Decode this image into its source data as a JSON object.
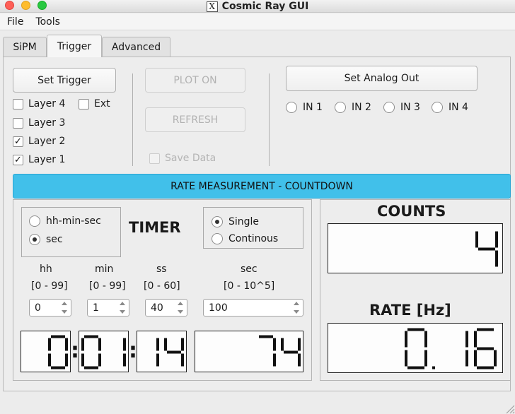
{
  "window": {
    "title": "Cosmic Ray GUI",
    "x_logo": "X"
  },
  "menu": [
    "File",
    "Tools"
  ],
  "tabs": [
    "SiPM",
    "Trigger",
    "Advanced"
  ],
  "trigger": {
    "set_trigger": "Set Trigger",
    "plot_on": "PLOT ON",
    "refresh": "REFRESH",
    "save_data": "Save Data",
    "set_analog_out": "Set Analog Out",
    "layers": [
      {
        "label": "Layer 4",
        "checked": false
      },
      {
        "label": "Layer 3",
        "checked": false
      },
      {
        "label": "Layer 2",
        "checked": true
      },
      {
        "label": "Layer 1",
        "checked": true
      }
    ],
    "ext": {
      "label": "Ext",
      "checked": false
    },
    "inputs": [
      "IN 1",
      "IN 2",
      "IN 3",
      "IN 4"
    ]
  },
  "rate": {
    "banner": "RATE MEASUREMENT - COUNTDOWN",
    "timer_title": "TIMER",
    "format_options": [
      {
        "label": "hh-min-sec",
        "selected": false
      },
      {
        "label": "sec",
        "selected": true
      }
    ],
    "mode_options": [
      {
        "label": "Single",
        "selected": true
      },
      {
        "label": "Continous",
        "selected": false
      }
    ],
    "fields": [
      {
        "name": "hh",
        "range": "[0 - 99]",
        "value": "0"
      },
      {
        "name": "min",
        "range": "[0 - 99]",
        "value": "1"
      },
      {
        "name": "ss",
        "range": "[0 - 60]",
        "value": "40"
      },
      {
        "name": "sec",
        "range": "[0 - 10^5]",
        "value": "100"
      }
    ],
    "countdown": {
      "hh": "0",
      "mm": "01",
      "ss": "14",
      "sec": "74"
    },
    "counts_label": "COUNTS",
    "counts_value": "4",
    "rate_label": "RATE [Hz]",
    "rate_value": "0.16"
  }
}
